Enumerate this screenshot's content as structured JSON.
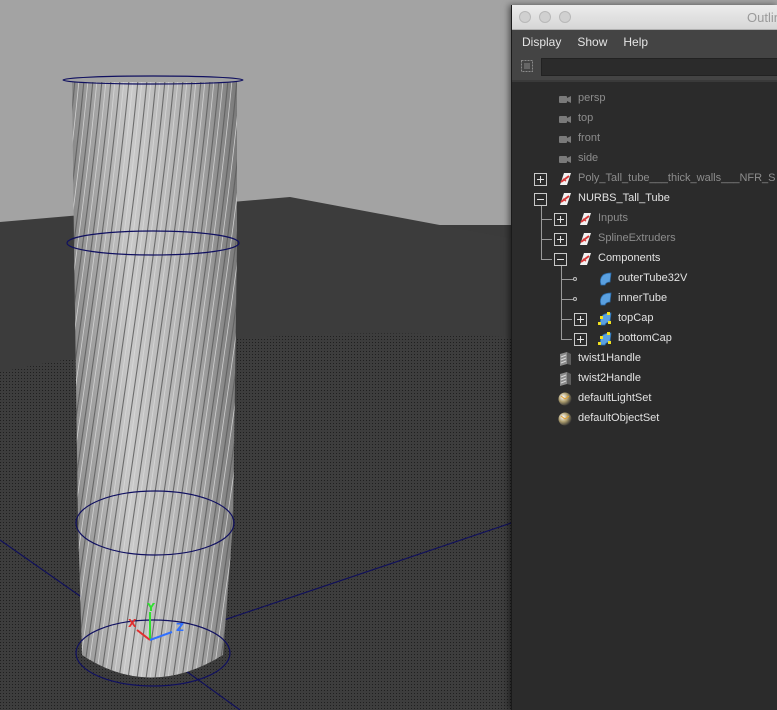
{
  "window": {
    "title": "Outliner"
  },
  "menu": [
    "Display",
    "Show",
    "Help"
  ],
  "search": {
    "value": "",
    "placeholder": ""
  },
  "tree": [
    {
      "label": "persp",
      "icon": "camera-icon",
      "dim": true,
      "depth": 0,
      "expander": "none"
    },
    {
      "label": "top",
      "icon": "camera-icon",
      "dim": true,
      "depth": 0,
      "expander": "none"
    },
    {
      "label": "front",
      "icon": "camera-icon",
      "dim": true,
      "depth": 0,
      "expander": "none"
    },
    {
      "label": "side",
      "icon": "camera-icon",
      "dim": true,
      "depth": 0,
      "expander": "none"
    },
    {
      "label": "Poly_Tall_tube___thick_walls___NFR_S",
      "icon": "transform-icon",
      "dim": true,
      "depth": 0,
      "expander": "plus"
    },
    {
      "label": "NURBS_Tall_Tube",
      "icon": "transform-icon",
      "dim": false,
      "depth": 0,
      "expander": "minus"
    },
    {
      "label": "Inputs",
      "icon": "transform-icon",
      "dim": true,
      "depth": 1,
      "expander": "plus"
    },
    {
      "label": "SplineExtruders",
      "icon": "transform-icon",
      "dim": true,
      "depth": 1,
      "expander": "plus"
    },
    {
      "label": "Components",
      "icon": "transform-icon",
      "dim": false,
      "depth": 1,
      "expander": "minus"
    },
    {
      "label": "outerTube32V",
      "icon": "nurbs-surface-icon",
      "dim": false,
      "depth": 2,
      "expander": "none"
    },
    {
      "label": "innerTube",
      "icon": "nurbs-surface-icon",
      "dim": false,
      "depth": 2,
      "expander": "none"
    },
    {
      "label": "topCap",
      "icon": "nurbs-selected-icon",
      "dim": false,
      "depth": 2,
      "expander": "plus"
    },
    {
      "label": "bottomCap",
      "icon": "nurbs-selected-icon",
      "dim": false,
      "depth": 2,
      "expander": "plus"
    },
    {
      "label": "twist1Handle",
      "icon": "deformer-handle-icon",
      "dim": false,
      "depth": 0,
      "expander": "none"
    },
    {
      "label": "twist2Handle",
      "icon": "deformer-handle-icon",
      "dim": false,
      "depth": 0,
      "expander": "none"
    },
    {
      "label": "defaultLightSet",
      "icon": "set-sphere-icon",
      "dim": false,
      "depth": 0,
      "expander": "none"
    },
    {
      "label": "defaultObjectSet",
      "icon": "set-sphere-icon",
      "dim": false,
      "depth": 0,
      "expander": "none"
    }
  ],
  "viewport": {
    "axis_labels": {
      "x": "X",
      "y": "Y",
      "z": "Z"
    },
    "colors": {
      "sky": "#a2a2a2",
      "ground": "#3b3b3b",
      "grid": "#0a0a2a",
      "x": "#e03030",
      "y": "#30e030",
      "z": "#3070ff"
    }
  },
  "colors": {
    "panel": "#2b2b2b",
    "menubar": "#444444",
    "selection_yellow": "#f0e020",
    "accent_red": "#d83a3a"
  }
}
